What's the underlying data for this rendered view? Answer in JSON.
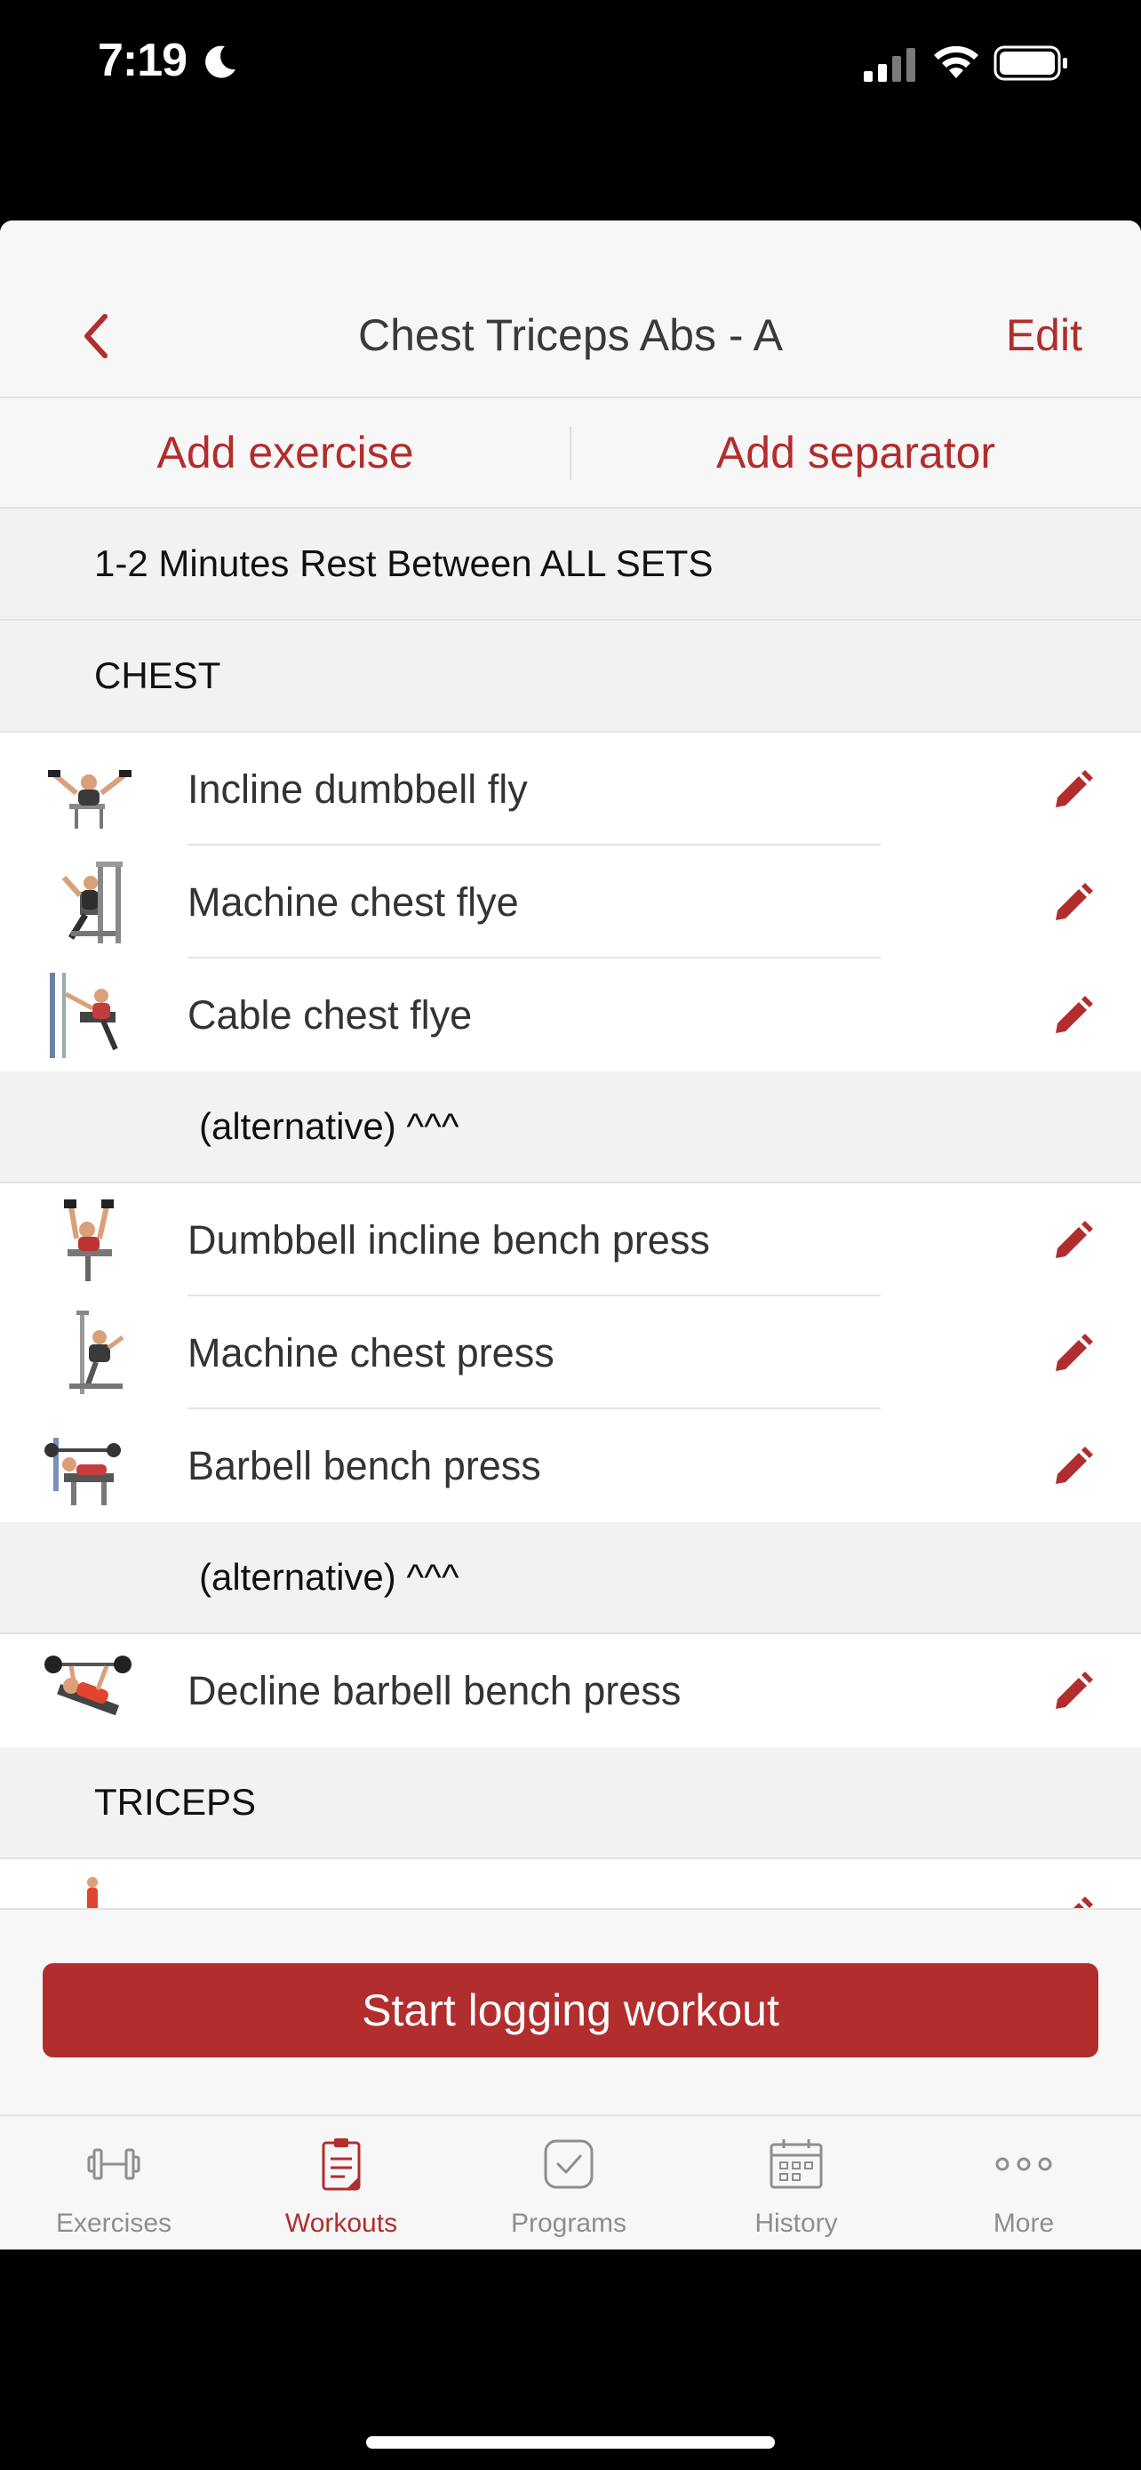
{
  "status": {
    "time": "7:19"
  },
  "nav": {
    "title": "Chest Triceps Abs - A",
    "edit": "Edit"
  },
  "actions": {
    "add_exercise": "Add exercise",
    "add_separator": "Add separator"
  },
  "list": [
    {
      "type": "separator",
      "label": "1-2 Minutes Rest Between ALL SETS"
    },
    {
      "type": "separator",
      "label": "CHEST"
    },
    {
      "type": "exercise",
      "name": "Incline dumbbell fly"
    },
    {
      "type": "exercise",
      "name": "Machine chest flye"
    },
    {
      "type": "exercise",
      "name": "Cable chest flye"
    },
    {
      "type": "separator",
      "label": "(alternative) ^^^"
    },
    {
      "type": "exercise",
      "name": "Dumbbell incline bench press"
    },
    {
      "type": "exercise",
      "name": "Machine chest press"
    },
    {
      "type": "exercise",
      "name": "Barbell bench press"
    },
    {
      "type": "separator",
      "label": "(alternative) ^^^"
    },
    {
      "type": "exercise",
      "name": "Decline barbell bench press"
    },
    {
      "type": "separator",
      "label": "TRICEPS"
    },
    {
      "type": "exercise",
      "name": ""
    }
  ],
  "start_button": "Start logging workout",
  "tabs": [
    {
      "label": "Exercises",
      "icon": "dumbbell-icon"
    },
    {
      "label": "Workouts",
      "icon": "clipboard-icon"
    },
    {
      "label": "Programs",
      "icon": "checkbox-icon"
    },
    {
      "label": "History",
      "icon": "calendar-icon"
    },
    {
      "label": "More",
      "icon": "more-dots-icon"
    }
  ],
  "active_tab": 1,
  "colors": {
    "accent": "#b22d2d",
    "inactive": "#8e8e8e",
    "background": "#f7f7f7"
  }
}
